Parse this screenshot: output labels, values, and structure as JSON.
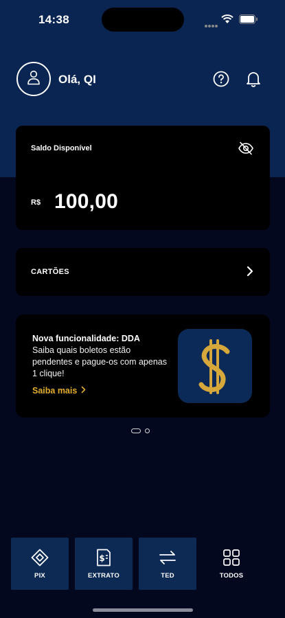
{
  "status_bar": {
    "time": "14:38"
  },
  "header": {
    "greeting": "Olá, QI"
  },
  "balance": {
    "title": "Saldo Disponível",
    "currency": "R$",
    "amount": "100,00"
  },
  "cards": {
    "label": "CARTÕES"
  },
  "promo": {
    "title": "Nova funcionalidade: DDA",
    "body": "Saiba quais boletos estão pendentes e pague-os com apenas 1 clique!",
    "link": "Saiba mais"
  },
  "actions": [
    {
      "label": "PIX",
      "icon": "pix-icon"
    },
    {
      "label": "EXTRATO",
      "icon": "statement-icon"
    },
    {
      "label": "TED",
      "icon": "transfer-arrows-icon"
    },
    {
      "label": "TODOS",
      "icon": "grid-icon"
    }
  ],
  "colors": {
    "header_blue": "#0a2552",
    "background": "#04081f",
    "accent_gold": "#e2ad2c",
    "action_blue": "#0d2a55"
  }
}
